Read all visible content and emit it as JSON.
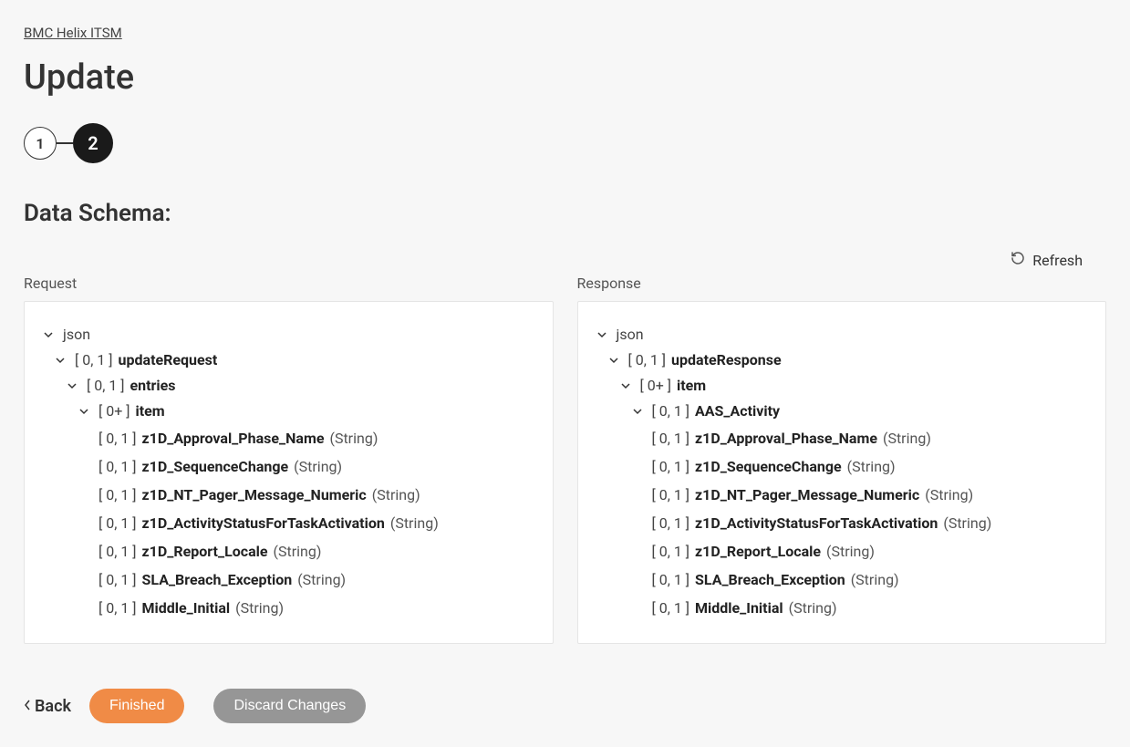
{
  "breadcrumb": "BMC Helix ITSM",
  "page_title": "Update",
  "stepper": {
    "step1": "1",
    "step2": "2"
  },
  "section_title": "Data Schema:",
  "refresh_label": "Refresh",
  "request": {
    "label": "Request",
    "root": "json",
    "node1": {
      "card": "[ 0, 1 ]",
      "name": "updateRequest"
    },
    "node2": {
      "card": "[ 0, 1 ]",
      "name": "entries"
    },
    "node3": {
      "card": "[ 0+ ]",
      "name": "item"
    },
    "leaves": [
      {
        "card": "[ 0, 1 ]",
        "name": "z1D_Approval_Phase_Name",
        "type": "(String)"
      },
      {
        "card": "[ 0, 1 ]",
        "name": "z1D_SequenceChange",
        "type": "(String)"
      },
      {
        "card": "[ 0, 1 ]",
        "name": "z1D_NT_Pager_Message_Numeric",
        "type": "(String)"
      },
      {
        "card": "[ 0, 1 ]",
        "name": "z1D_ActivityStatusForTaskActivation",
        "type": "(String)"
      },
      {
        "card": "[ 0, 1 ]",
        "name": "z1D_Report_Locale",
        "type": "(String)"
      },
      {
        "card": "[ 0, 1 ]",
        "name": "SLA_Breach_Exception",
        "type": "(String)"
      },
      {
        "card": "[ 0, 1 ]",
        "name": "Middle_Initial",
        "type": "(String)"
      }
    ]
  },
  "response": {
    "label": "Response",
    "root": "json",
    "node1": {
      "card": "[ 0, 1 ]",
      "name": "updateResponse"
    },
    "node2": {
      "card": "[ 0+ ]",
      "name": "item"
    },
    "node3": {
      "card": "[ 0, 1 ]",
      "name": "AAS_Activity"
    },
    "leaves": [
      {
        "card": "[ 0, 1 ]",
        "name": "z1D_Approval_Phase_Name",
        "type": "(String)"
      },
      {
        "card": "[ 0, 1 ]",
        "name": "z1D_SequenceChange",
        "type": "(String)"
      },
      {
        "card": "[ 0, 1 ]",
        "name": "z1D_NT_Pager_Message_Numeric",
        "type": "(String)"
      },
      {
        "card": "[ 0, 1 ]",
        "name": "z1D_ActivityStatusForTaskActivation",
        "type": "(String)"
      },
      {
        "card": "[ 0, 1 ]",
        "name": "z1D_Report_Locale",
        "type": "(String)"
      },
      {
        "card": "[ 0, 1 ]",
        "name": "SLA_Breach_Exception",
        "type": "(String)"
      },
      {
        "card": "[ 0, 1 ]",
        "name": "Middle_Initial",
        "type": "(String)"
      }
    ]
  },
  "footer": {
    "back": "Back",
    "finished": "Finished",
    "discard": "Discard Changes"
  }
}
